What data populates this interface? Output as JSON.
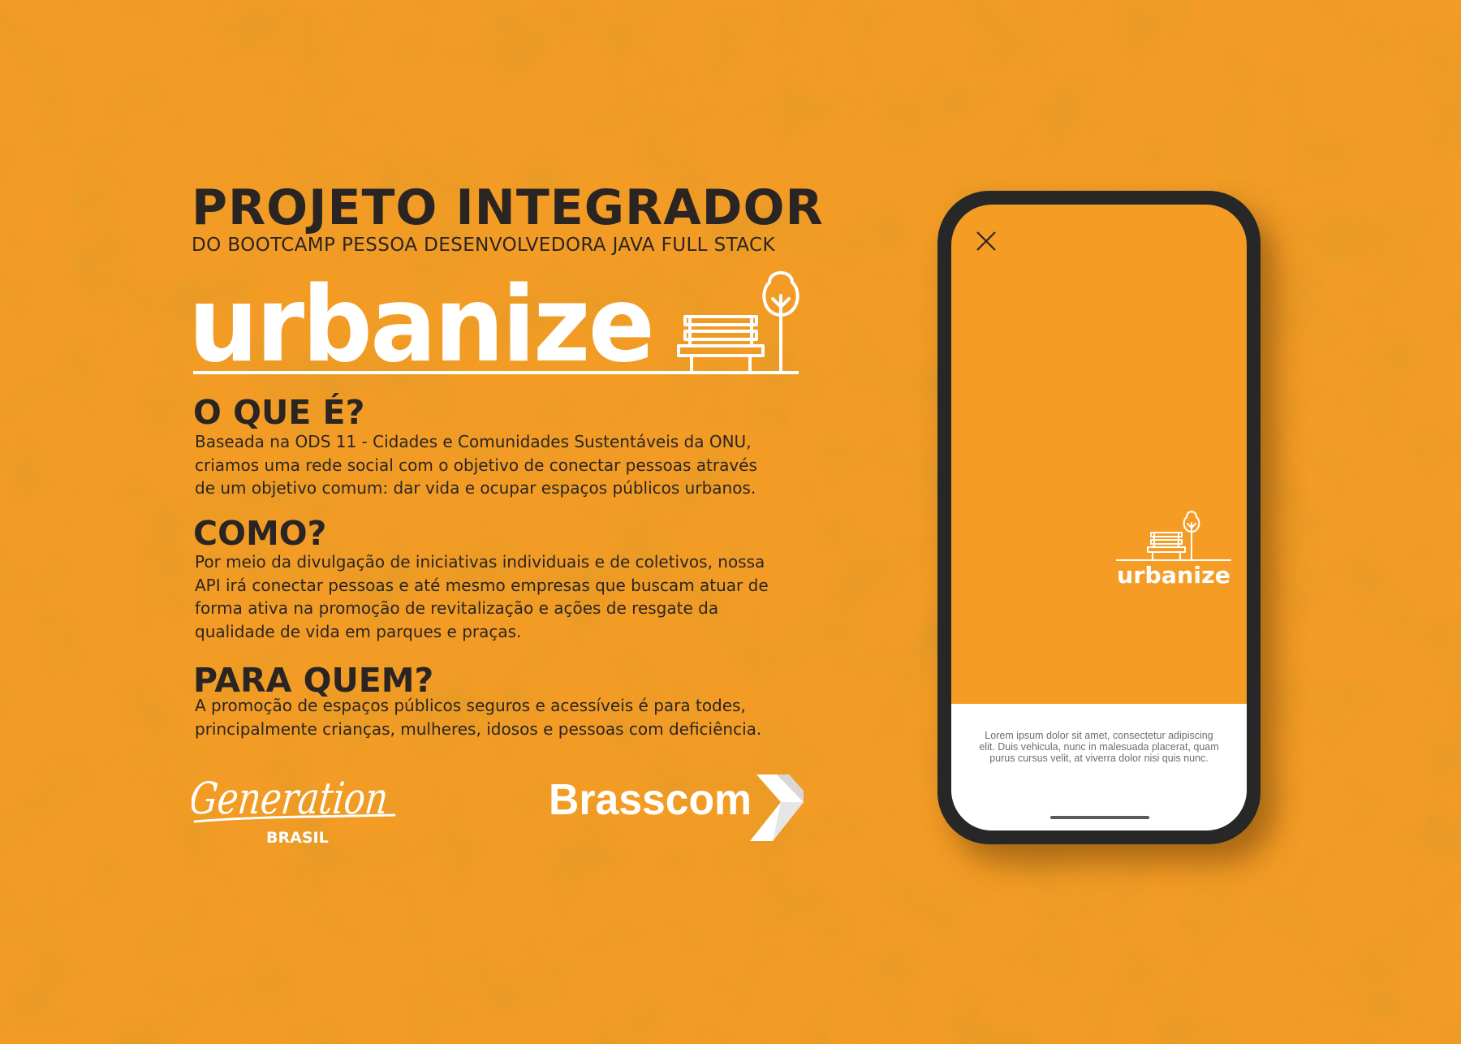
{
  "header": {
    "title": "PROJETO INTEGRADOR",
    "subtitle": "DO BOOTCAMP PESSOA DESENVOLVEDORA JAVA FULL STACK"
  },
  "brand": {
    "name": "urbanize",
    "icon": "bench-and-tree-icon",
    "background_color": "#f49c25",
    "text_color": "#2a2523"
  },
  "sections": [
    {
      "heading": "O QUE É?",
      "lines": [
        "Baseada na ODS 11 - Cidades e Comunidades Sustentáveis  da ONU,",
        "criamos uma rede social com o objetivo de conectar pessoas através",
        "de um objetivo comum: dar vida e ocupar espaços públicos urbanos."
      ]
    },
    {
      "heading": "COMO?",
      "lines": [
        "Por meio da divulgação de iniciativas individuais e de coletivos, nossa",
        "API irá conectar pessoas e até mesmo empresas que buscam atuar de",
        "forma ativa na promoção de revitalização e ações de resgate da",
        "qualidade de vida em parques e praças."
      ]
    },
    {
      "heading": "PARA QUEM?",
      "lines": [
        "A promoção de espaços públicos seguros e acessíveis é para todes,",
        "principalmente crianças, mulheres, idosos e pessoas com deficiência."
      ]
    }
  ],
  "partners": {
    "generation": {
      "name": "Generation",
      "sub": "BRASIL"
    },
    "brasscom": {
      "name": "Brasscom"
    }
  },
  "phone": {
    "close_icon": "close-icon",
    "logo_text": "urbanize",
    "lorem": "Lorem ipsum dolor sit amet, consectetur adipiscing elit. Duis vehicula, nunc in malesuada placerat, quam purus cursus velit, at viverra dolor nisi quis nunc."
  }
}
